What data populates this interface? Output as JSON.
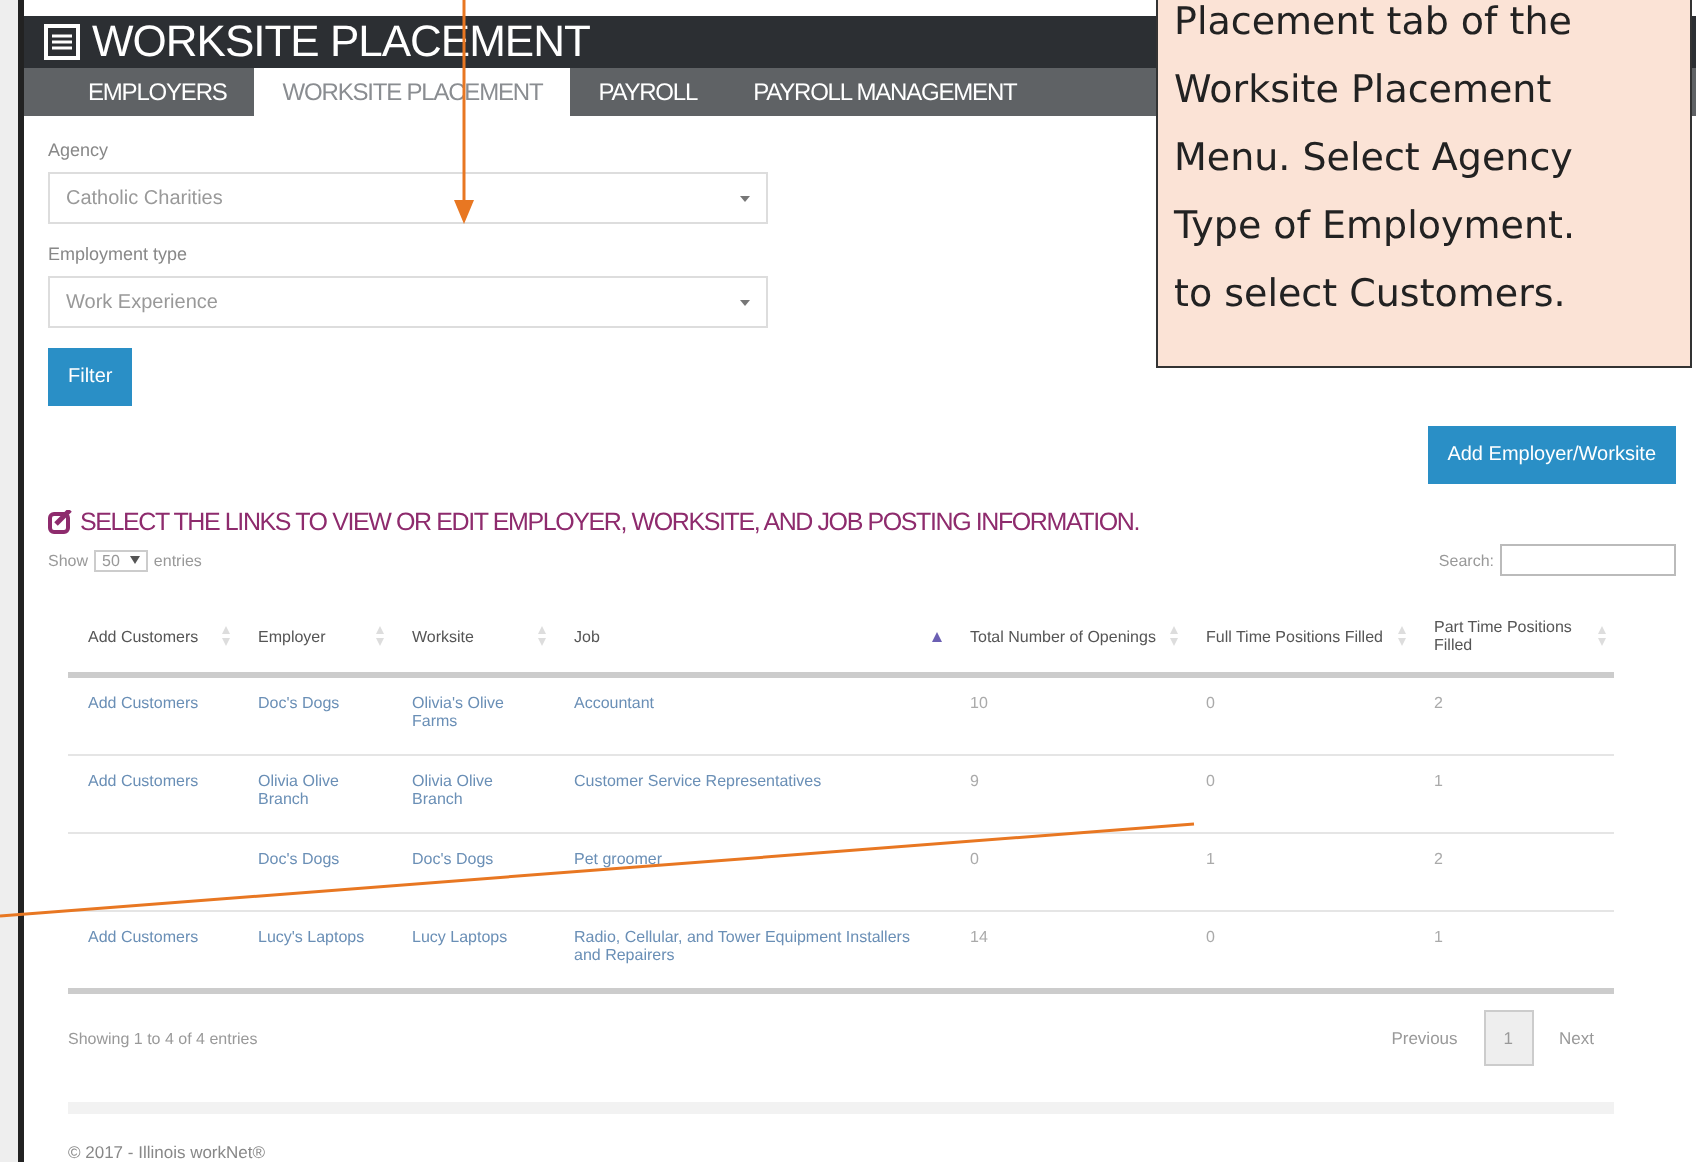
{
  "app": {
    "title": "WORKSITE PLACEMENT"
  },
  "tabs": [
    {
      "label": "EMPLOYERS",
      "selected": false
    },
    {
      "label": "WORKSITE PLACEMENT",
      "selected": true
    },
    {
      "label": "PAYROLL",
      "selected": false
    },
    {
      "label": "PAYROLL MANAGEMENT",
      "selected": false
    }
  ],
  "filters": [
    {
      "label": "Agency",
      "value": "Catholic Charities"
    },
    {
      "label": "Employment type",
      "value": "Work Experience"
    }
  ],
  "filter_button": "Filter",
  "add_button": "Add Employer/Worksite",
  "section_title": "SELECT THE LINKS TO VIEW OR EDIT EMPLOYER, WORKSITE, AND JOB POSTING INFORMATION.",
  "length": {
    "before": "Show",
    "value": "50",
    "after": "entries"
  },
  "search": {
    "label": "Search:"
  },
  "table": {
    "columns": [
      {
        "label": "Add Customers",
        "sorted": false
      },
      {
        "label": "Employer",
        "sorted": false
      },
      {
        "label": "Worksite",
        "sorted": false
      },
      {
        "label": "Job",
        "sorted": true
      },
      {
        "label": "Total Number of Openings",
        "sorted": false
      },
      {
        "label": "Full Time Positions Filled",
        "sorted": false
      },
      {
        "label": "Part Time Positions Filled",
        "sorted": false
      }
    ],
    "rows": [
      [
        "Add Customers",
        "Doc's Dogs",
        "Olivia's Olive Farms",
        "Accountant",
        "10",
        "0",
        "2"
      ],
      [
        "Add Customers",
        "Olivia Olive Branch",
        "Olivia Olive Branch",
        "Customer Service Representatives",
        "9",
        "0",
        "1"
      ],
      [
        "",
        "Doc's Dogs",
        "Doc's Dogs",
        "Pet groomer",
        "0",
        "1",
        "2"
      ],
      [
        "Add Customers",
        "Lucy's Laptops",
        "Lucy Laptops",
        "Radio, Cellular, and Tower Equipment Installers and Repairers",
        "14",
        "0",
        "1"
      ]
    ]
  },
  "info": "Showing 1 to 4 of 4 entries",
  "pagination": [
    {
      "label": "Previous",
      "selected": false
    },
    {
      "label": "1",
      "selected": true
    },
    {
      "label": "Next",
      "selected": false
    }
  ],
  "footer": "© 2017 - Illinois workNet®",
  "callout": {
    "lines": [
      "Placement tab of the",
      "Worksite Placement",
      "Menu. Select Agency",
      "Type of Employment.",
      "to select Customers."
    ]
  }
}
